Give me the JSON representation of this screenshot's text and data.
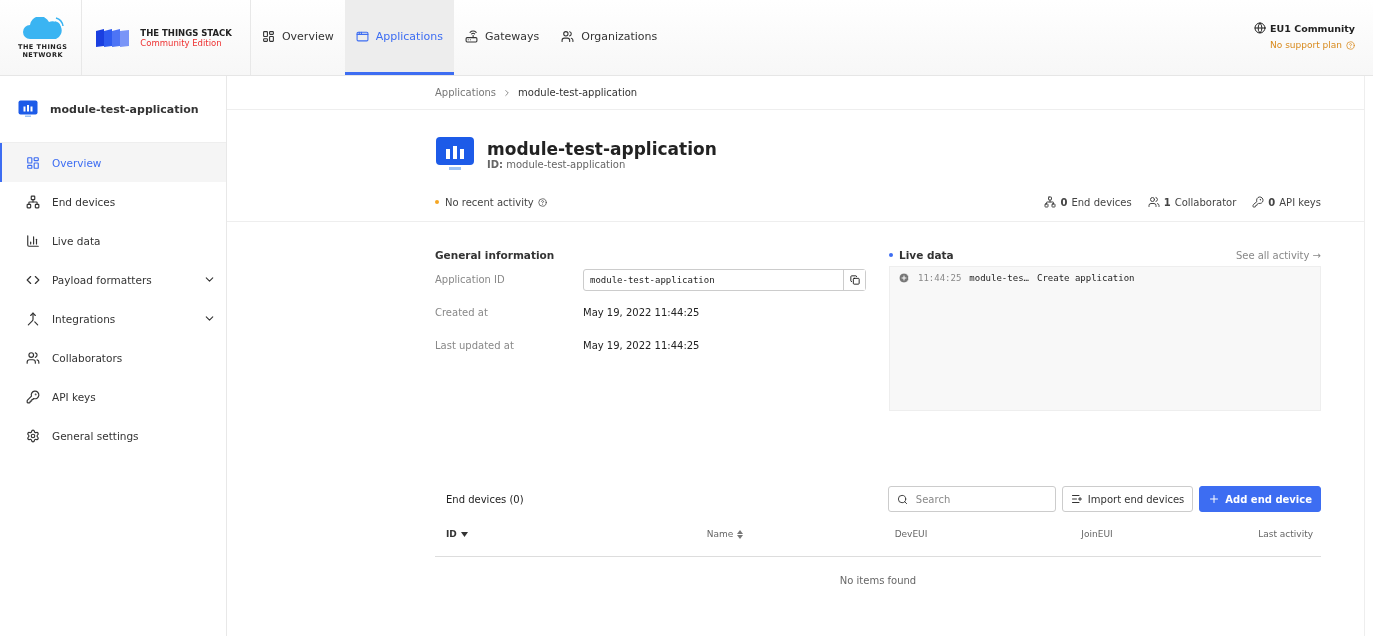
{
  "brand": {
    "network": [
      "THE THINGS",
      "NETWORK"
    ],
    "stack": "THE THINGS STACK",
    "edition": "Community Edition"
  },
  "nav": [
    {
      "label": "Overview",
      "selected": false
    },
    {
      "label": "Applications",
      "selected": true
    },
    {
      "label": "Gateways",
      "selected": false
    },
    {
      "label": "Organizations",
      "selected": false
    }
  ],
  "cluster": {
    "name": "EU1 Community",
    "plan": "No support plan"
  },
  "sidebar": {
    "title": "module-test-application",
    "items": [
      {
        "label": "Overview",
        "selected": true
      },
      {
        "label": "End devices",
        "selected": false
      },
      {
        "label": "Live data",
        "selected": false
      },
      {
        "label": "Payload formatters",
        "selected": false,
        "expanded": false
      },
      {
        "label": "Integrations",
        "selected": false,
        "expanded": false
      },
      {
        "label": "Collaborators",
        "selected": false
      },
      {
        "label": "API keys",
        "selected": false
      },
      {
        "label": "General settings",
        "selected": false
      }
    ]
  },
  "breadcrumbs": [
    "Applications",
    "module-test-application"
  ],
  "header": {
    "title": "module-test-application",
    "id_label": "ID:",
    "id": "module-test-application",
    "activity": "No recent activity",
    "stats": [
      {
        "count": "0",
        "label": "End devices"
      },
      {
        "count": "1",
        "label": "Collaborator"
      },
      {
        "count": "0",
        "label": "API keys"
      }
    ]
  },
  "general": {
    "title": "General information",
    "rows": [
      {
        "label": "Application ID",
        "value": "module-test-application",
        "kind": "field"
      },
      {
        "label": "Created at",
        "value": "May 19, 2022 11:44:25",
        "kind": "text"
      },
      {
        "label": "Last updated at",
        "value": "May 19, 2022 11:44:25",
        "kind": "text"
      }
    ]
  },
  "live": {
    "title": "Live data",
    "link": "See all activity →",
    "events": [
      {
        "time": "11:44:25",
        "entity": "module-tes…",
        "name": "Create application"
      }
    ]
  },
  "devices": {
    "title": "End devices (0)",
    "search": {
      "placeholder": "Search"
    },
    "import": "Import end devices",
    "add": "Add end device",
    "columns": [
      {
        "label": "ID",
        "sortable": true,
        "sorted": true
      },
      {
        "label": "Name",
        "sortable": true,
        "sorted": false
      },
      {
        "label": "DevEUI"
      },
      {
        "label": "JoinEUI"
      },
      {
        "label": "Last activity"
      }
    ],
    "empty": "No items found"
  }
}
